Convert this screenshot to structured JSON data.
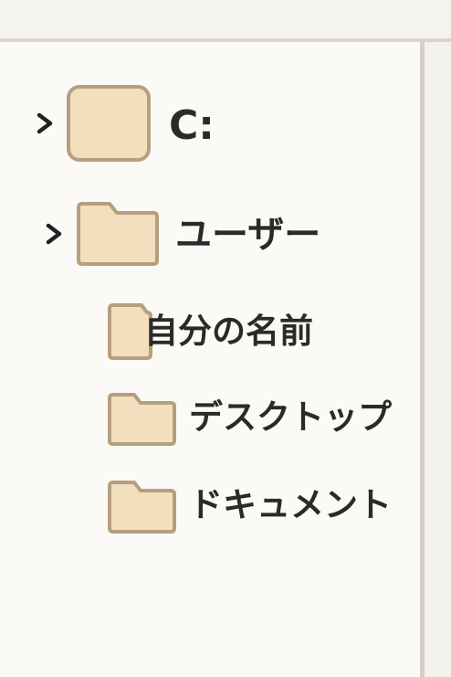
{
  "tree": {
    "drive": {
      "label": "C:",
      "icon": "drive-icon",
      "expand_icon": "chevron-right-icon"
    },
    "users": {
      "label": "ユーザー",
      "icon": "folder-icon",
      "expand_icon": "chevron-right-icon"
    },
    "children": [
      {
        "label": "自分の名前",
        "icon": "folder-icon"
      },
      {
        "label": "デスクトップ",
        "icon": "folder-icon"
      },
      {
        "label": "ドキュメント",
        "icon": "folder-icon"
      }
    ]
  },
  "colors": {
    "background": "#fbfaf6",
    "folder_fill": "#f1dfbe",
    "folder_stroke": "#b59f7f",
    "text": "#2a2a28",
    "divider": "#d9d5cb"
  }
}
